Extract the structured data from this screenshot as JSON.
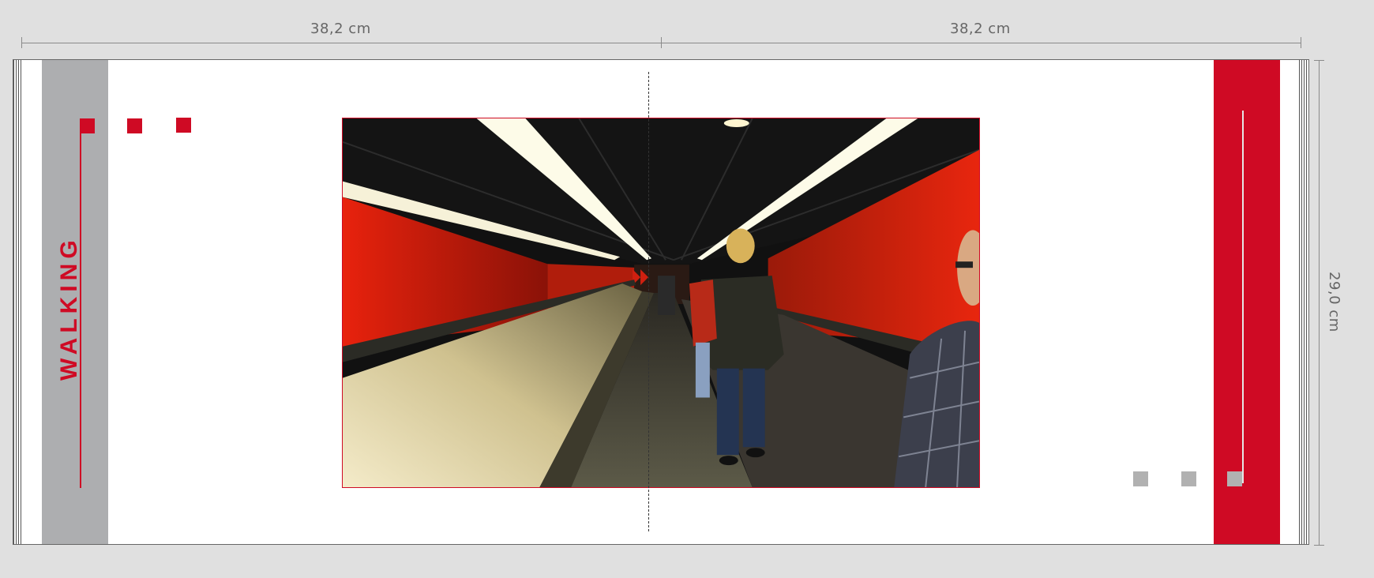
{
  "dimensions": {
    "left_width": "38,2 cm",
    "right_width": "38,2 cm",
    "height": "29,0 cm"
  },
  "spread": {
    "left_page": {
      "vertical_title": "WALKING",
      "accent_color": "#cf0a24",
      "band_color": "#adaeb0"
    },
    "right_page": {
      "band_color": "#cf0a24",
      "square_color": "#b1b1b1"
    },
    "photo": {
      "subject": "moving-walkway-tunnel",
      "border_color": "#cf0a24"
    }
  },
  "icons": [
    "square-bullet-icon"
  ]
}
